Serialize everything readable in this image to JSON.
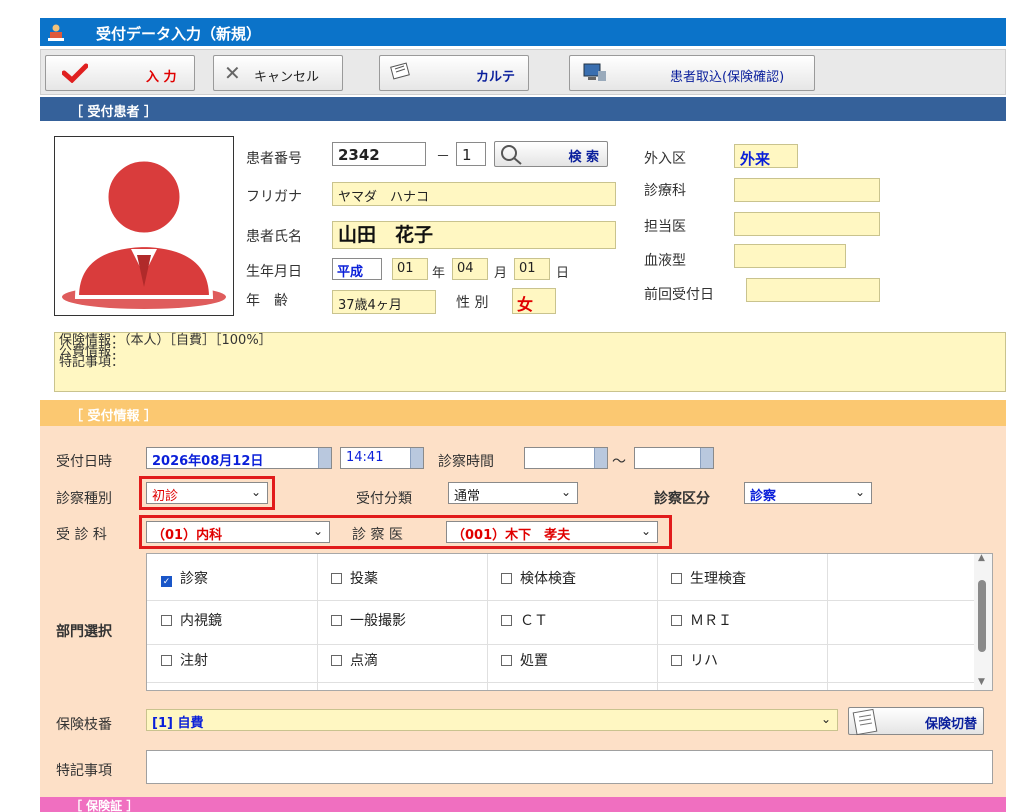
{
  "window": {
    "title": "受付データ入力（新規）"
  },
  "toolbar": {
    "submit_label": "入 力",
    "cancel_label": "キャンセル",
    "chart_label": "カルテ",
    "import_label": "患者取込(保険確認)"
  },
  "patient_section": {
    "title": "［ 受付患者 ］"
  },
  "patient": {
    "id_label": "患者番号",
    "id_value": "2342",
    "dash": "－",
    "branch_value": "1",
    "search_label": "検 索",
    "kana_label": "フリガナ",
    "kana_value": "ヤマダ　ハナコ",
    "name_label": "患者氏名",
    "name_value": "山田　花子",
    "dob_label": "生年月日",
    "era": "平成",
    "year": "01",
    "year_unit": "年",
    "month": "04",
    "month_unit": "月",
    "day": "01",
    "day_unit": "日",
    "age_label": "年　齢",
    "age_value": "37歳4ヶ月",
    "sex_label": "性 別",
    "sex_value": "女",
    "inout_label": "外入区",
    "inout_value": "外来",
    "dept_label": "診療科",
    "doctor_label": "担当医",
    "blood_label": "血液型",
    "last_visit_label": "前回受付日"
  },
  "info_area": {
    "line1": "保険情報：（本人）［自費］［100%］",
    "line2": "公費情報：",
    "line3": "特記事項："
  },
  "reception_section": {
    "title": "［ 受付情報 ］"
  },
  "reception": {
    "datetime_label": "受付日時",
    "date_value": "2026年08月12日",
    "time_value": "14:41",
    "exam_time_label": "診察時間",
    "tilde": "～",
    "exam_type_label": "診察種別",
    "exam_type_value": "初診",
    "reception_class_label": "受付分類",
    "reception_class_value": "通常",
    "exam_class_label": "診察区分",
    "exam_class_value": "診察",
    "dept_label": "受 診 科",
    "dept_value": "（01）内科",
    "doctor_label": "診 察 医",
    "doctor_value": "（001）木下　孝夫",
    "section_select_label": "部門選択",
    "departments": [
      {
        "label": "診察",
        "checked": true
      },
      {
        "label": "投薬",
        "checked": false
      },
      {
        "label": "検体検査",
        "checked": false
      },
      {
        "label": "生理検査",
        "checked": false
      },
      {
        "label": "内視鏡",
        "checked": false
      },
      {
        "label": "一般撮影",
        "checked": false
      },
      {
        "label": "ＣＴ",
        "checked": false
      },
      {
        "label": "ＭＲＩ",
        "checked": false
      },
      {
        "label": "注射",
        "checked": false
      },
      {
        "label": "点滴",
        "checked": false
      },
      {
        "label": "処置",
        "checked": false
      },
      {
        "label": "リハ",
        "checked": false
      }
    ],
    "insurance_branch_label": "保険枝番",
    "insurance_branch_value": "[1] 自費",
    "insurance_switch_label": "保険切替",
    "special_notes_label": "特記事項"
  },
  "insurance_section": {
    "title": "［ 保険証 ］"
  },
  "colors": {
    "title_bar": "#0b73c9",
    "patient_header": "#35619a",
    "reception_header": "#fbc871",
    "insurance_header": "#f06fc0",
    "highlight": "#e11b1b"
  }
}
